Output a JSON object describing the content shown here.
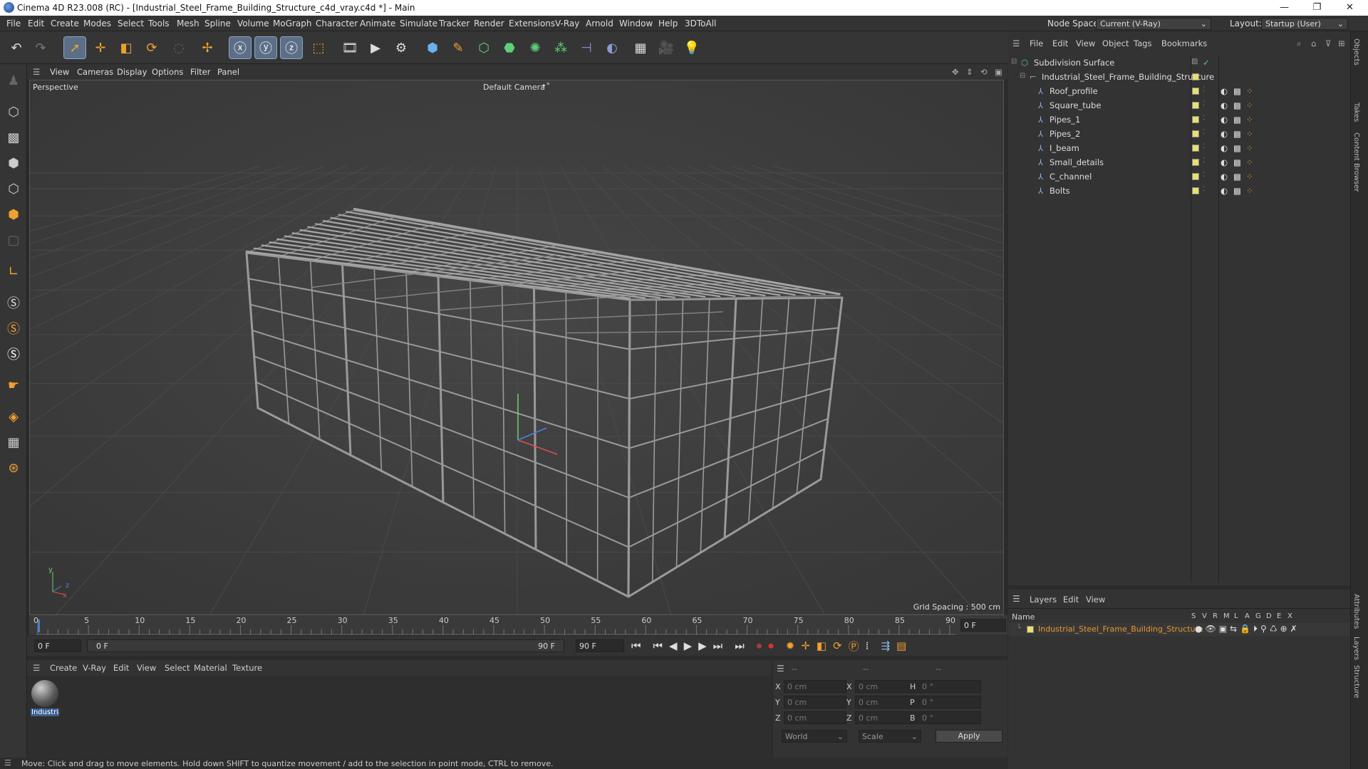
{
  "titlebar": {
    "title": "Cinema 4D R23.008 (RC) - [Industrial_Steel_Frame_Building_Structure_c4d_vray.c4d *] - Main",
    "min": "—",
    "max": "❐",
    "close": "✕"
  },
  "menu": {
    "items": [
      "File",
      "Edit",
      "Create",
      "Modes",
      "Select",
      "Tools",
      "Mesh",
      "Spline",
      "Volume",
      "MoGraph",
      "Character",
      "Animate",
      "Simulate",
      "Tracker",
      "Render",
      "Extensions",
      "V-Ray",
      "Arnold",
      "Window",
      "Help",
      "3DToAll"
    ],
    "node_space_label": "Node Space:",
    "node_space_value": "Current (V-Ray)",
    "layout_label": "Layout:",
    "layout_value": "Startup (User)"
  },
  "viewport": {
    "menu": [
      "View",
      "Cameras",
      "Display",
      "Options",
      "Filter",
      "Panel"
    ],
    "view_name": "Perspective",
    "camera": "Default Camera",
    "grid_spacing": "Grid Spacing : 500 cm",
    "axis_y": "y",
    "axis_z": "z",
    "axis_x": "x"
  },
  "timeline": {
    "ticks": [
      "0",
      "5",
      "10",
      "15",
      "20",
      "25",
      "30",
      "35",
      "40",
      "45",
      "50",
      "55",
      "60",
      "65",
      "70",
      "75",
      "80",
      "85",
      "90"
    ],
    "current": "0 F"
  },
  "transport": {
    "start": "0 F",
    "range_start": "0 F",
    "range_end": "90 F",
    "end": "90 F"
  },
  "materials": {
    "menu": [
      "Create",
      "V-Ray",
      "Edit",
      "View",
      "Select",
      "Material",
      "Texture"
    ],
    "swatch_label": "Industria"
  },
  "coords": {
    "header": [
      "--",
      "--",
      "--"
    ],
    "rows": [
      {
        "a": "X",
        "av": "0 cm",
        "b": "X",
        "bv": "0 cm",
        "c": "H",
        "cv": "0 °"
      },
      {
        "a": "Y",
        "av": "0 cm",
        "b": "Y",
        "bv": "0 cm",
        "c": "P",
        "cv": "0 °"
      },
      {
        "a": "Z",
        "av": "0 cm",
        "b": "Z",
        "bv": "0 cm",
        "c": "B",
        "cv": "0 °"
      }
    ],
    "world": "World",
    "scale": "Scale",
    "apply": "Apply"
  },
  "status": {
    "text": "Move: Click and drag to move elements. Hold down SHIFT to quantize movement / add to the selection in point mode, CTRL to remove."
  },
  "objects": {
    "menu": [
      "File",
      "Edit",
      "View",
      "Object",
      "Tags",
      "Bookmarks"
    ],
    "root": "Subdivision Surface",
    "group": "Industrial_Steel_Frame_Building_Structure",
    "children": [
      "Roof_profile",
      "Square_tube",
      "Pipes_1",
      "Pipes_2",
      "I_beam",
      "Small_details",
      "C_channel",
      "Bolts"
    ]
  },
  "layers": {
    "menu": [
      "Layers",
      "Edit",
      "View"
    ],
    "name_header": "Name",
    "cols": [
      "S",
      "V",
      "R",
      "M",
      "L",
      "A",
      "G",
      "D",
      "E",
      "X"
    ],
    "layer": "Industrial_Steel_Frame_Building_Structure"
  },
  "sidetabs": [
    "Objects",
    "Takes",
    "Content Browser",
    "Attributes",
    "Layers",
    "Structure"
  ],
  "colors": {
    "accent_orange": "#f0a030",
    "layer_orange": "#e8962e",
    "viewport_bg": "#3d3d3d",
    "selected_blue": "#5c6f87"
  }
}
